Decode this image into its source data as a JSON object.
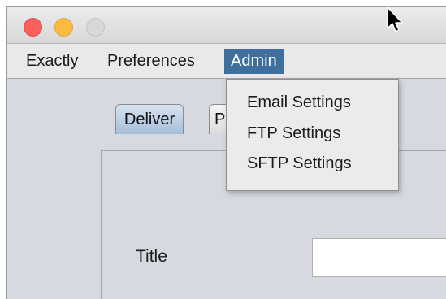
{
  "menubar": {
    "items": [
      {
        "label": "Exactly"
      },
      {
        "label": "Preferences"
      },
      {
        "label": "Admin"
      }
    ]
  },
  "admin_menu": {
    "items": [
      {
        "label": "Email Settings"
      },
      {
        "label": "FTP Settings"
      },
      {
        "label": "SFTP Settings"
      }
    ]
  },
  "tabs": [
    {
      "label": "Deliver"
    },
    {
      "label": "P"
    }
  ],
  "form": {
    "title_label": "Title",
    "title_value": ""
  },
  "colors": {
    "menu_highlight": "#3f6f9d",
    "window_bg": "#d6d9df",
    "close": "#fc605c",
    "minimize": "#fdbc40",
    "maximize_disabled": "#d8d8d8"
  }
}
